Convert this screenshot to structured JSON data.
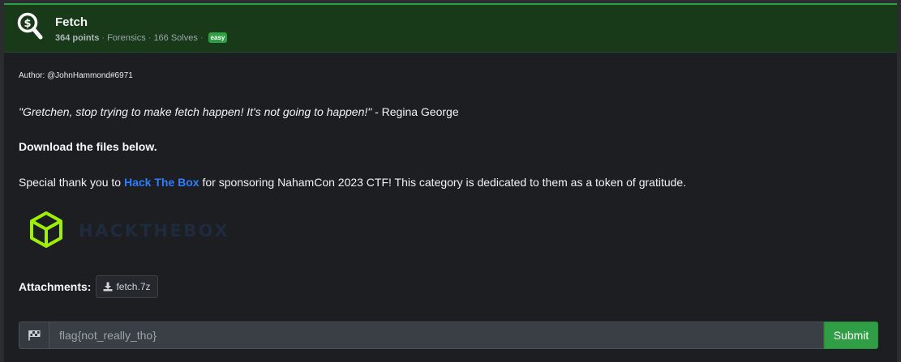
{
  "challenge": {
    "title": "Fetch",
    "points": "364 points",
    "category": "Forensics",
    "solves": "166 Solves",
    "difficulty": "easy",
    "separator": "·"
  },
  "description": {
    "author": "Author: @JohnHammond#6971",
    "quote": "\"Gretchen, stop trying to make fetch happen! It's not going to happen!\"",
    "quote_attribution": " - Regina George",
    "download_note": "Download the files below.",
    "thanks_prefix": "Special thank you to ",
    "thanks_link": "Hack The Box",
    "thanks_suffix": " for sponsoring NahamCon 2023 CTF! This category is dedicated to them as a token of gratitude.",
    "logo_text": "HACKTHEBOX"
  },
  "attachments": {
    "label": "Attachments:",
    "files": [
      "fetch.7z"
    ]
  },
  "flag_form": {
    "placeholder": "flag{not_really_tho}",
    "submit_label": "Submit"
  },
  "colors": {
    "accent_green": "#2f9e44",
    "header_bg": "#193a19",
    "link_blue": "#2b7fff",
    "htb_green": "#9fef00"
  },
  "icons": {
    "header": "search-dollar-icon",
    "flag": "flag-checkered-icon",
    "download": "download-icon",
    "logo": "hackthebox-cube-icon"
  }
}
